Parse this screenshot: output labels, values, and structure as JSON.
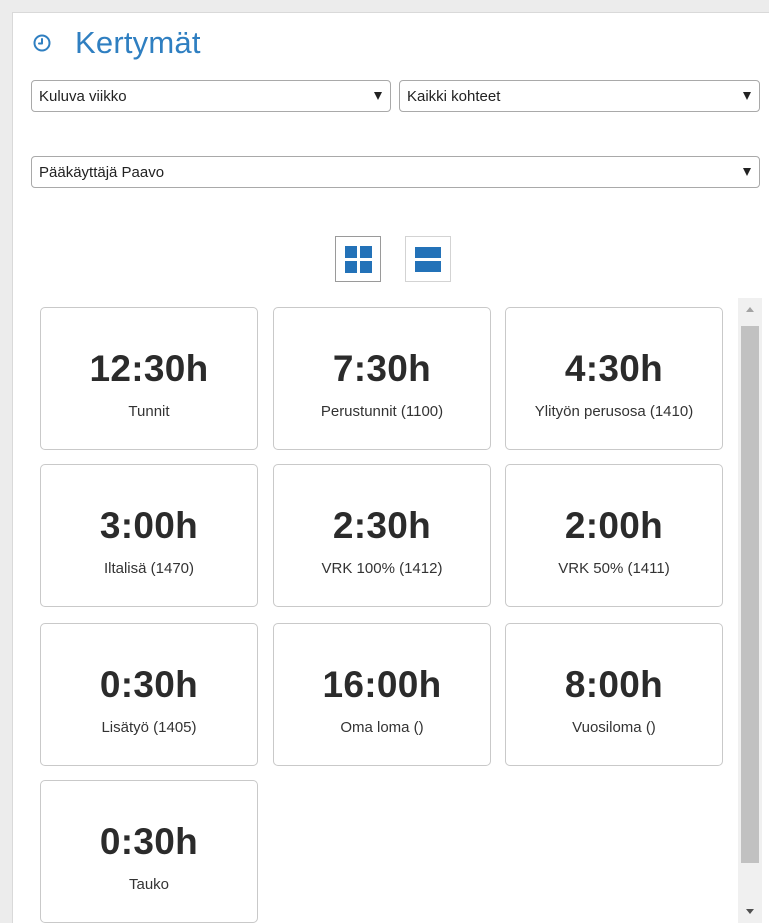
{
  "header": {
    "title": "Kertymät",
    "icon": "clock-icon"
  },
  "filters": {
    "period": "Kuluva viikko",
    "target": "Kaikki kohteet",
    "user": "Pääkäyttäjä Paavo"
  },
  "view_modes": {
    "grid": "grid-view-icon",
    "list": "list-view-icon",
    "selected": "grid"
  },
  "accent_color": "#2372b8",
  "cards": [
    {
      "value": "12:30h",
      "label": "Tunnit"
    },
    {
      "value": "7:30h",
      "label": "Perustunnit (1100)"
    },
    {
      "value": "4:30h",
      "label": "Ylityön perusosa (1410)"
    },
    {
      "value": "3:00h",
      "label": "Iltalisä (1470)"
    },
    {
      "value": "2:30h",
      "label": "VRK 100% (1412)"
    },
    {
      "value": "2:00h",
      "label": "VRK 50% (1411)"
    },
    {
      "value": "0:30h",
      "label": "Lisätyö (1405)"
    },
    {
      "value": "16:00h",
      "label": "Oma loma ()"
    },
    {
      "value": "8:00h",
      "label": "Vuosiloma ()"
    },
    {
      "value": "0:30h",
      "label": "Tauko"
    }
  ]
}
